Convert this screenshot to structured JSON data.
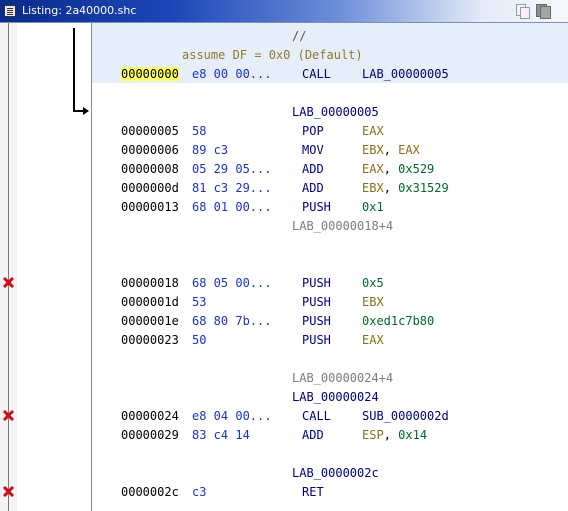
{
  "window": {
    "title": "Listing:  2a40000.shc",
    "icons": [
      "listing-icon",
      "copy-icon",
      "snapshot-icon"
    ]
  },
  "listing": {
    "comment": "//",
    "assume": "assume DF = 0x0  (Default)",
    "instr_0": {
      "address": "00000000",
      "bytes": "e8 00 00...",
      "mnemonic": "CALL",
      "operand": "LAB_00000005"
    },
    "label_5": "LAB_00000005",
    "instr_5": {
      "address": "00000005",
      "bytes": "58",
      "mnemonic": "POP",
      "op1": "EAX"
    },
    "instr_6": {
      "address": "00000006",
      "bytes": "89 c3",
      "mnemonic": "MOV",
      "op1": "EBX",
      "sep": ",",
      "op2": "EAX"
    },
    "instr_8": {
      "address": "00000008",
      "bytes": "05 29 05...",
      "mnemonic": "ADD",
      "op1": "EAX",
      "sep": ",",
      "op2": "0x529"
    },
    "instr_d": {
      "address": "0000000d",
      "bytes": "81 c3 29...",
      "mnemonic": "ADD",
      "op1": "EBX",
      "sep": ",",
      "op2": "0x31529"
    },
    "instr_13": {
      "address": "00000013",
      "bytes": "68 01 00...",
      "mnemonic": "PUSH",
      "op1": "0x1"
    },
    "ref_18": "LAB_00000018+4",
    "instr_18": {
      "address": "00000018",
      "bytes": "68 05 00...",
      "mnemonic": "PUSH",
      "op1": "0x5"
    },
    "instr_1d": {
      "address": "0000001d",
      "bytes": "53",
      "mnemonic": "PUSH",
      "op1": "EBX"
    },
    "instr_1e": {
      "address": "0000001e",
      "bytes": "68 80 7b...",
      "mnemonic": "PUSH",
      "op1": "0xed1c7b80"
    },
    "instr_23": {
      "address": "00000023",
      "bytes": "50",
      "mnemonic": "PUSH",
      "op1": "EAX"
    },
    "ref_24": "LAB_00000024+4",
    "label_24": "LAB_00000024",
    "instr_24": {
      "address": "00000024",
      "bytes": "e8 04 00...",
      "mnemonic": "CALL",
      "op1": "SUB_0000002d"
    },
    "instr_29": {
      "address": "00000029",
      "bytes": "83 c4 14",
      "mnemonic": "ADD",
      "op1": "ESP",
      "sep": ",",
      "op2": "0x14"
    },
    "label_2c": "LAB_0000002c",
    "instr_2c": {
      "address": "0000002c",
      "bytes": "c3",
      "mnemonic": "RET"
    }
  },
  "colors": {
    "address": "#000000",
    "bytes": "#1a33c8",
    "mnemonic": "#000080",
    "register": "#8b6f16",
    "scalar": "#006b2c",
    "label": "#00007a",
    "xref": "#7d7d7d",
    "address_highlight": "#ffff66",
    "current_line_band": "#e6eefa",
    "error_mark": "#c8101c"
  },
  "margin_markers": [
    "error-x-icon",
    "error-x-icon",
    "error-x-icon"
  ]
}
